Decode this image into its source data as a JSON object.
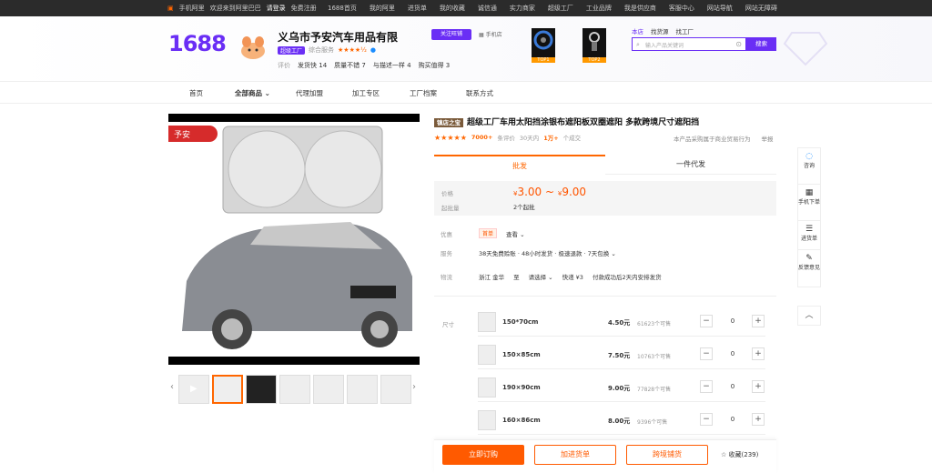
{
  "topbar": {
    "mobile_label": "手机阿里",
    "welcome": "欢迎来到阿里巴巴",
    "login": "请登录",
    "register": "免费注册",
    "links": [
      "1688首页",
      "我的阿里",
      "进货单",
      "我的收藏",
      "诚信通",
      "实力商家",
      "超级工厂",
      "工业品牌",
      "我是供应商",
      "客服中心",
      "网站导航",
      "网站无障碍"
    ]
  },
  "header": {
    "logo": "1688",
    "shop_name": "义乌市予安汽车用品有限",
    "shop_badge": "超级工厂",
    "shop_subtext": "综合服务",
    "shop_stars": "★★★★½",
    "follow_label": "关注旺铺",
    "mobile_shop_label": "手机店",
    "stats": {
      "label": "评价",
      "items": [
        {
          "name": "发货快",
          "value": "14"
        },
        {
          "name": "质量不错",
          "value": "7"
        },
        {
          "name": "与描述一样",
          "value": "4"
        },
        {
          "name": "购买值得",
          "value": "3"
        }
      ]
    },
    "promo_tags": [
      "TOP1",
      "TOP2"
    ],
    "search_tabs": [
      "本店",
      "找货源",
      "找工厂"
    ],
    "search_placeholder": "输入产品关键词",
    "search_button": "搜索"
  },
  "nav": {
    "items": [
      "首页",
      "全部商品",
      "代理加盟",
      "加工专区",
      "工厂档案",
      "联系方式"
    ]
  },
  "gallery": {
    "brand_tag": "予安"
  },
  "product": {
    "title_tag": "镇店之宝",
    "title": "超级工厂车用太阳挡涂银布遮阳板双圈遮阳 多款跨境尺寸遮阳挡",
    "stars": "★★★★★",
    "review_count": "7000+",
    "review_label": "条评价",
    "deal_period": "30天内",
    "deal_count": "1万+",
    "deal_label": "个成交",
    "procurement_note": "本产品采购属于商业贸易行为",
    "report_label": "举报",
    "tabs": [
      "批发",
      "一件代发"
    ],
    "price_label": "价格",
    "price_low": "3.00",
    "price_high": "9.00",
    "currency": "¥",
    "moq_label": "起批量",
    "moq_value": "2个起批",
    "discount_label": "优惠",
    "discount_tag": "首单",
    "discount_action": "查看",
    "service_label": "服务",
    "service_value": "38天免费赊账 · 48小时发货 · 极速退款 · 7天包换",
    "ship_label": "物流",
    "ship_from": "浙江 金华",
    "ship_to_label": "至",
    "ship_to": "请选择",
    "ship_fee": "快递 ¥3",
    "ship_note": "付款成功后2天内安排发货",
    "sku_label": "尺寸",
    "skus": [
      {
        "name": "150*70cm",
        "price": "4.50元",
        "stock": "61623个可售",
        "qty": "0"
      },
      {
        "name": "150×85cm",
        "price": "7.50元",
        "stock": "10763个可售",
        "qty": "0"
      },
      {
        "name": "190×90cm",
        "price": "9.00元",
        "stock": "77828个可售",
        "qty": "0"
      },
      {
        "name": "160×86cm",
        "price": "8.00元",
        "stock": "9396个可售",
        "qty": "0"
      }
    ]
  },
  "actions": {
    "order": "立即订购",
    "add_cart": "加进货单",
    "cross_border": "跨境铺货",
    "favorite": "收藏(239)"
  },
  "sidetool": {
    "items": [
      "咨询",
      "手机下单",
      "进货单",
      "反馈意见"
    ]
  }
}
